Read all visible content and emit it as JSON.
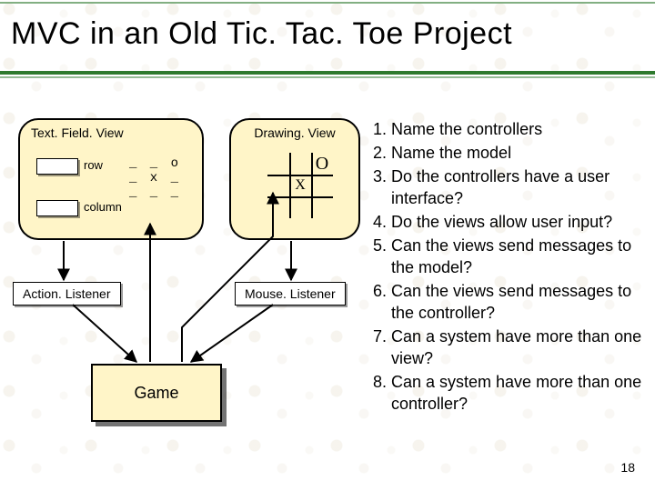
{
  "title": "MVC in an Old Tic. Tac. Toe Project",
  "textfield_view": {
    "label": "Text. Field. View",
    "row_label": "row",
    "column_label": "column",
    "ascii_board": "_ _ o\n_ x _\n_ _ _"
  },
  "drawing_view": {
    "label": "Drawing. View",
    "mark_center": "X",
    "mark_corner": "O"
  },
  "listeners": {
    "action": "Action. Listener",
    "mouse": "Mouse. Listener"
  },
  "game_label": "Game",
  "questions": [
    "Name the controllers",
    "Name the model",
    "Do the controllers have a user interface?",
    "Do the views allow user input?",
    "Can the views send messages to the model?",
    "Can the views send messages to the controller?",
    "Can a system have more than one view?",
    "Can a system have more than one controller?"
  ],
  "page_number": "18"
}
